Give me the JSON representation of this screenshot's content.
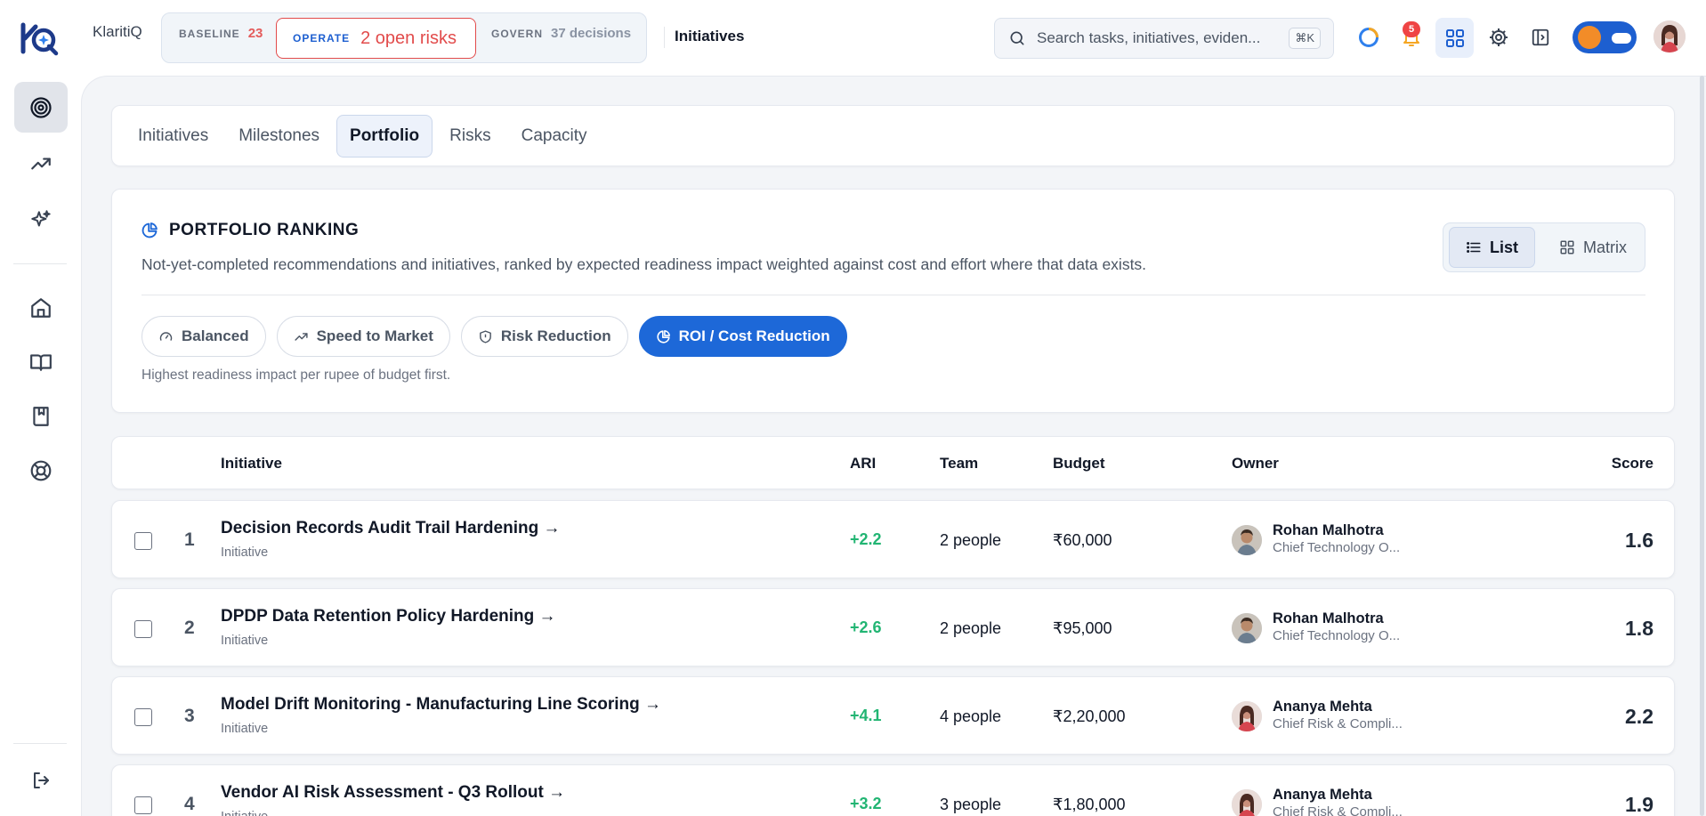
{
  "app": {
    "brand": "KlaritiQ",
    "breadcrumb": "Initiatives"
  },
  "phases": {
    "baseline_label": "BASELINE",
    "baseline_count": "23",
    "operate_label": "OPERATE",
    "operate_risks": "2 open risks",
    "govern_label": "GOVERN",
    "govern_decisions": "37 decisions"
  },
  "search": {
    "placeholder": "Search tasks, initiatives, eviden...",
    "shortcut": "⌘K"
  },
  "notifications": {
    "count": "5"
  },
  "tabs": [
    {
      "label": "Initiatives",
      "active": false
    },
    {
      "label": "Milestones",
      "active": false
    },
    {
      "label": "Portfolio",
      "active": true
    },
    {
      "label": "Risks",
      "active": false
    },
    {
      "label": "Capacity",
      "active": false
    }
  ],
  "ranking": {
    "title": "PORTFOLIO RANKING",
    "description": "Not-yet-completed recommendations and initiatives, ranked by expected readiness impact weighted against cost and effort where that data exists.",
    "views": {
      "list": "List",
      "matrix": "Matrix"
    },
    "strategies": [
      {
        "label": "Balanced",
        "icon": "gauge-icon",
        "active": false
      },
      {
        "label": "Speed to Market",
        "icon": "trending-up-icon",
        "active": false
      },
      {
        "label": "Risk Reduction",
        "icon": "shield-icon",
        "active": false
      },
      {
        "label": "ROI / Cost Reduction",
        "icon": "pie-chart-icon",
        "active": true
      }
    ],
    "hint": "Highest readiness impact per rupee of budget first."
  },
  "table": {
    "headers": {
      "initiative": "Initiative",
      "ari": "ARI",
      "team": "Team",
      "budget": "Budget",
      "owner": "Owner",
      "score": "Score"
    },
    "rows": [
      {
        "rank": "1",
        "title": "Decision Records Audit Trail Hardening →",
        "type": "Initiative",
        "ari": "+2.2",
        "team": "2 people",
        "budget": "₹60,000",
        "owner_name": "Rohan Malhotra",
        "owner_role": "Chief Technology O...",
        "score": "1.6"
      },
      {
        "rank": "2",
        "title": "DPDP Data Retention Policy Hardening →",
        "type": "Initiative",
        "ari": "+2.6",
        "team": "2 people",
        "budget": "₹95,000",
        "owner_name": "Rohan Malhotra",
        "owner_role": "Chief Technology O...",
        "score": "1.8"
      },
      {
        "rank": "3",
        "title": "Model Drift Monitoring - Manufacturing Line Scoring →",
        "type": "Initiative",
        "ari": "+4.1",
        "team": "4 people",
        "budget": "₹2,20,000",
        "owner_name": "Ananya Mehta",
        "owner_role": "Chief Risk & Compli...",
        "score": "2.2"
      },
      {
        "rank": "4",
        "title": "Vendor AI Risk Assessment - Q3 Rollout →",
        "type": "Initiative",
        "ari": "+3.2",
        "team": "3 people",
        "budget": "₹1,80,000",
        "owner_name": "Ananya Mehta",
        "owner_role": "Chief Risk & Compli...",
        "score": "1.9"
      }
    ]
  },
  "colors": {
    "accent": "#1d68d8",
    "risk": "#e24b4b",
    "positive": "#22b573"
  }
}
